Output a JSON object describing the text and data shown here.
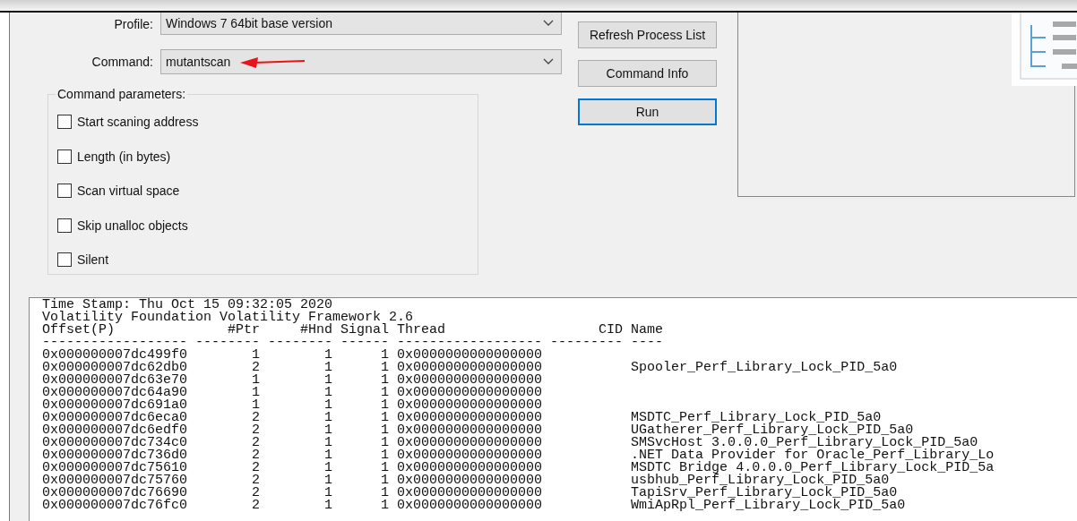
{
  "form": {
    "fields": [
      {
        "label": "Profile:",
        "value": "Windows 7 64bit base version",
        "annotated": false
      },
      {
        "label": "Command:",
        "value": "mutantscan",
        "annotated": true
      }
    ],
    "parameters": {
      "title": "Command parameters:",
      "options": [
        {
          "label": "Start scaning address",
          "checked": false
        },
        {
          "label": "Length (in bytes)",
          "checked": false
        },
        {
          "label": "Scan virtual space",
          "checked": false
        },
        {
          "label": "Skip unalloc objects",
          "checked": false
        },
        {
          "label": "Silent",
          "checked": false
        }
      ]
    }
  },
  "buttons": [
    {
      "label": "Refresh Process List",
      "focused": false
    },
    {
      "label": "Command Info",
      "focused": false
    },
    {
      "label": "Run",
      "focused": true
    }
  ],
  "console": {
    "lines": [
      "Time Stamp: Thu Oct 15 09:32:05 2020",
      "Volatility Foundation Volatility Framework 2.6",
      "Offset(P)              #Ptr     #Hnd Signal Thread                   CID Name",
      "------------------ -------- -------- ------ ------------------ --------- ----",
      "0x000000007dc499f0        1        1      1 0x0000000000000000",
      "0x000000007dc62db0        2        1      1 0x0000000000000000           Spooler_Perf_Library_Lock_PID_5a0",
      "0x000000007dc63e70        1        1      1 0x0000000000000000",
      "0x000000007dc64a90        1        1      1 0x0000000000000000",
      "0x000000007dc691a0        1        1      1 0x0000000000000000",
      "0x000000007dc6eca0        2        1      1 0x0000000000000000           MSDTC_Perf_Library_Lock_PID_5a0",
      "0x000000007dc6edf0        2        1      1 0x0000000000000000           UGatherer_Perf_Library_Lock_PID_5a0",
      "0x000000007dc734c0        2        1      1 0x0000000000000000           SMSvcHost 3.0.0.0_Perf_Library_Lock_PID_5a0",
      "0x000000007dc736d0        2        1      1 0x0000000000000000           .NET Data Provider for Oracle_Perf_Library_Lo",
      "0x000000007dc75610        2        1      1 0x0000000000000000           MSDTC Bridge 4.0.0.0_Perf_Library_Lock_PID_5a",
      "0x000000007dc75760        2        1      1 0x0000000000000000           usbhub_Perf_Library_Lock_PID_5a0",
      "0x000000007dc76690        2        1      1 0x0000000000000000           TapiSrv_Perf_Library_Lock_PID_5a0",
      "0x000000007dc76fc0        2        1      1 0x0000000000000000           WmiApRpl_Perf_Library_Lock_PID_5a0"
    ]
  }
}
